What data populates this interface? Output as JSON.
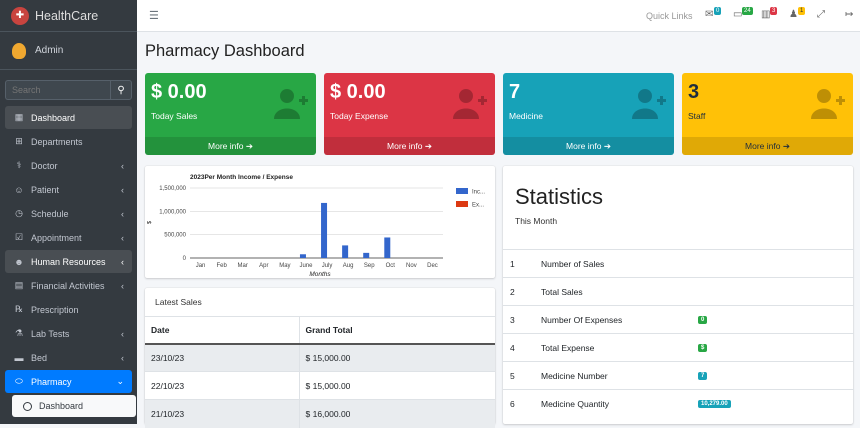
{
  "brand": {
    "name": "HealthCare"
  },
  "user": {
    "name": "Admin"
  },
  "search": {
    "placeholder": "Search"
  },
  "sidebar": {
    "items": [
      {
        "label": "Dashboard",
        "icon": "grid-icon"
      },
      {
        "label": "Departments",
        "icon": "sitemap-icon"
      },
      {
        "label": "Doctor",
        "icon": "doctor-icon"
      },
      {
        "label": "Patient",
        "icon": "user-icon"
      },
      {
        "label": "Schedule",
        "icon": "clock-icon"
      },
      {
        "label": "Appointment",
        "icon": "calendar-check-icon"
      },
      {
        "label": "Human Resources",
        "icon": "users-icon"
      },
      {
        "label": "Financial Activities",
        "icon": "money-icon"
      },
      {
        "label": "Prescription",
        "icon": "prescription-icon"
      },
      {
        "label": "Lab Tests",
        "icon": "flask-icon"
      },
      {
        "label": "Bed",
        "icon": "bed-icon"
      },
      {
        "label": "Pharmacy",
        "icon": "pills-icon"
      }
    ],
    "sub_item": "Dashboard"
  },
  "topbar": {
    "quick_links": "Quick Links",
    "badges": [
      "0",
      "24",
      "3",
      "1"
    ]
  },
  "page": {
    "title": "Pharmacy Dashboard"
  },
  "boxes": [
    {
      "value": "$ 0.00",
      "label": "Today Sales",
      "more": "More info",
      "color": "#28a745"
    },
    {
      "value": "$ 0.00",
      "label": "Today Expense",
      "more": "More info",
      "color": "#dc3545"
    },
    {
      "value": "7",
      "label": "Medicine",
      "more": "More info",
      "color": "#17a2b8"
    },
    {
      "value": "3",
      "label": "Staff",
      "more": "More info",
      "color": "#ffc107"
    }
  ],
  "chart_data": {
    "type": "bar",
    "title": "2023Per Month Income / Expense",
    "xlabel": "Months",
    "ylabel": "$",
    "ylim": [
      0,
      1500000
    ],
    "yticks": [
      "1,500,000",
      "1,000,000",
      "500,000",
      "0"
    ],
    "categories": [
      "Jan",
      "Feb",
      "Mar",
      "Apr",
      "May",
      "June",
      "July",
      "Aug",
      "Sep",
      "Oct",
      "Nov",
      "Dec"
    ],
    "series": [
      {
        "name": "Inc...",
        "color": "#3366cc",
        "values": [
          0,
          0,
          0,
          0,
          0,
          80000,
          1180000,
          270000,
          110000,
          440000,
          0,
          0
        ]
      },
      {
        "name": "Ex...",
        "color": "#dc3912",
        "values": [
          0,
          0,
          0,
          0,
          0,
          0,
          0,
          0,
          0,
          0,
          0,
          0
        ]
      }
    ],
    "legend": "right"
  },
  "stats": {
    "title": "Statistics",
    "period": "This Month",
    "rows": [
      {
        "n": "1",
        "label": "Number of Sales",
        "badge": ""
      },
      {
        "n": "2",
        "label": "Total Sales",
        "badge": ""
      },
      {
        "n": "3",
        "label": "Number Of Expenses",
        "badge": "0",
        "color": "#28a745"
      },
      {
        "n": "4",
        "label": "Total Expense",
        "badge": "$",
        "color": "#28a745"
      },
      {
        "n": "5",
        "label": "Medicine Number",
        "badge": "7",
        "color": "#17a2b8"
      },
      {
        "n": "6",
        "label": "Medicine Quantity",
        "badge": "10,279.00",
        "color": "#17a2b8"
      }
    ]
  },
  "latest_sales": {
    "title": "Latest Sales",
    "headers": [
      "Date",
      "Grand Total"
    ],
    "rows": [
      [
        "23/10/23",
        "$ 15,000.00"
      ],
      [
        "22/10/23",
        "$ 15,000.00"
      ],
      [
        "21/10/23",
        "$ 16,000.00"
      ]
    ]
  }
}
